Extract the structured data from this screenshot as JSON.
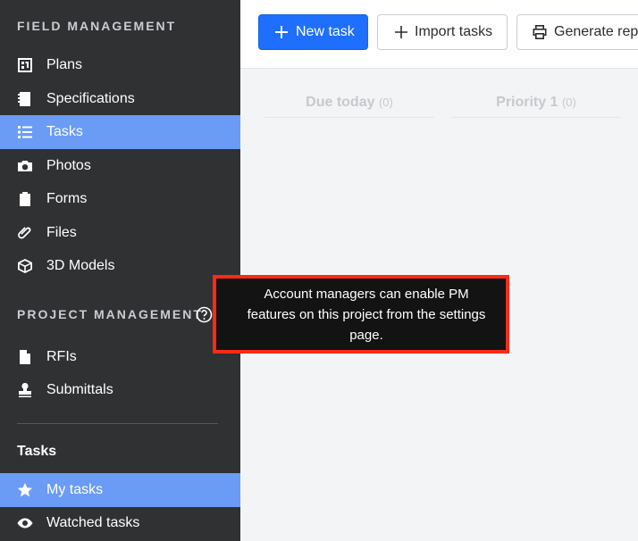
{
  "sidebar": {
    "field_title": "FIELD MANAGEMENT",
    "field_items": [
      {
        "label": "Plans",
        "icon": "plans-icon"
      },
      {
        "label": "Specifications",
        "icon": "specifications-icon"
      },
      {
        "label": "Tasks",
        "icon": "list-icon",
        "active": true
      },
      {
        "label": "Photos",
        "icon": "camera-icon"
      },
      {
        "label": "Forms",
        "icon": "clipboard-icon"
      },
      {
        "label": "Files",
        "icon": "paperclip-icon"
      },
      {
        "label": "3D Models",
        "icon": "cube-icon"
      }
    ],
    "project_title": "PROJECT MANAGEMENT",
    "project_items": [
      {
        "label": "RFIs",
        "icon": "rfi-document-icon"
      },
      {
        "label": "Submittals",
        "icon": "stamp-icon"
      }
    ],
    "tasks_heading": "Tasks",
    "tasks_items": [
      {
        "label": "My tasks",
        "icon": "star-icon",
        "active": true
      },
      {
        "label": "Watched tasks",
        "icon": "eye-icon"
      }
    ]
  },
  "toolbar": {
    "new_task_label": "New task",
    "import_tasks_label": "Import tasks",
    "generate_report_label": "Generate rep"
  },
  "columns": [
    {
      "title": "Due today",
      "count": "(0)"
    },
    {
      "title": "Priority 1",
      "count": "(0)"
    }
  ],
  "tooltip": {
    "text": "Account managers can enable PM features on this project from the settings page."
  },
  "colors": {
    "sidebar_bg": "#2f3133",
    "active_bg": "#6b9cf5",
    "primary_button": "#1f6fff",
    "highlight_border": "#ff2a16"
  }
}
